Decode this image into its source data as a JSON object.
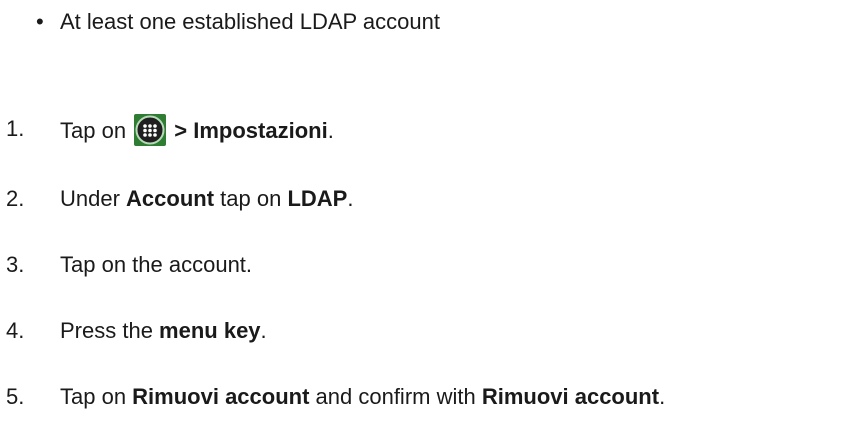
{
  "prerequisite": {
    "bullet": "•",
    "text": "At least one established LDAP account"
  },
  "steps": [
    {
      "number": "1.",
      "parts": [
        "Tap on ",
        "",
        " > Impostazioni",
        "."
      ],
      "icon": "apps-grid-icon"
    },
    {
      "number": "2.",
      "parts": [
        "Under ",
        "Account",
        " tap on ",
        "LDAP",
        "."
      ]
    },
    {
      "number": "3.",
      "text": "Tap on the account."
    },
    {
      "number": "4.",
      "parts": [
        "Press the ",
        "menu key",
        "."
      ]
    },
    {
      "number": "5.",
      "parts": [
        "Tap on ",
        "Rimuovi account",
        " and confirm with ",
        "Rimuovi account",
        "."
      ]
    }
  ],
  "colors": {
    "text": "#1a1a1a",
    "icon_bg": "#2e7d32",
    "icon_ring": "#43a047",
    "icon_dots": "#ffffff"
  }
}
